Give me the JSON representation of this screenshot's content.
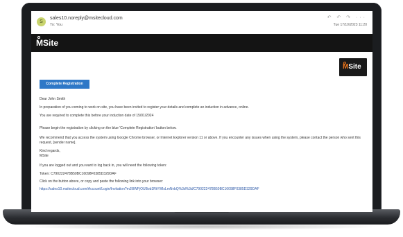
{
  "email": {
    "avatar_letter": "S",
    "sender": "sales10.noreply@msitecloud.com",
    "to": "To: You",
    "date": "Tue 17/10/2023 11:20",
    "actions": "↶ ↶ ↷ ···"
  },
  "brand": {
    "name": "Site",
    "m_letter": "M"
  },
  "button": {
    "label": "Complete Registration"
  },
  "body": {
    "greeting": "Dear John Smith",
    "intro": "In preparation of you coming to work on site, you have been invited to register your details and complete an induction in advance, online.",
    "deadline": "You are required to complete this before your induction date of 15/01/2024",
    "begin": "Please begin the registration by clicking on the blue 'Complete Registration' button below.",
    "recommend": "We recommend that you access the system using Google Chrome browser, or Internet Explorer version 11 or above. If you encounter any issues when using the system, please contact the person who sent this request, [sender name].",
    "regards": "Kind regards,",
    "signoff": "MSite",
    "logged_out": "If you are logged out and you want to log back in, you will need the following token:",
    "token": "Token: C790222478B50BC16098F0385D329DAF",
    "click_info": "Click on the button above, or copy and paste the following link into your browser:",
    "link": "https://sales10.msitecloud.com/Account/Login/Invitation?mJ9lWFjOUBob3RtYWlsLmNvbQ%3d%3d/C790222478B50BC16098F0385D329DAF"
  },
  "colors": {
    "button": "#2e78c7",
    "banner": "#141414",
    "accent": "#e8731a",
    "link": "#2e5aa8"
  }
}
